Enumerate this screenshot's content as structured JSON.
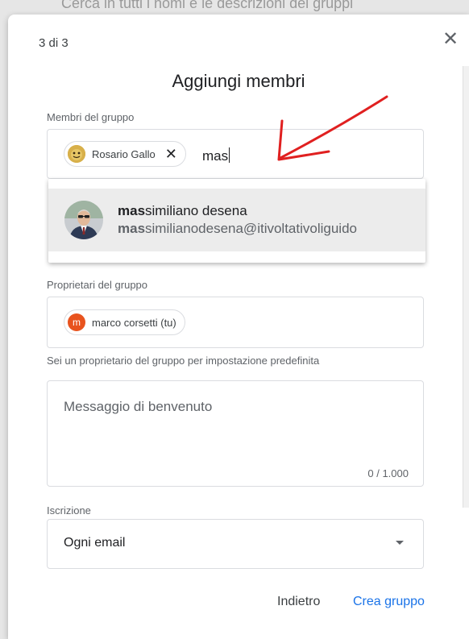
{
  "background": {
    "text": "Cerca in tutti i nomi e le descrizioni dei gruppi"
  },
  "dialog": {
    "step": "3 di 3",
    "title": "Aggiungi membri",
    "close_icon": "close-icon"
  },
  "members": {
    "label": "Membri del gruppo",
    "chips": [
      {
        "name": "Rosario Gallo",
        "remove": "✕"
      }
    ],
    "typed_value": "mas"
  },
  "suggestion": {
    "name_match": "mas",
    "name_rest": "similiano desena",
    "email_match": "mas",
    "email_rest": "similianodesena@itivoltativoliguido"
  },
  "owners": {
    "label": "Proprietari del gruppo",
    "chip": {
      "initial": "m",
      "name": "marco corsetti (tu)",
      "color": "#e8531e"
    },
    "hint": "Sei un proprietario del gruppo per impostazione predefinita"
  },
  "welcome": {
    "placeholder": "Messaggio di benvenuto",
    "counter": "0 / 1.000"
  },
  "subscription": {
    "label": "Iscrizione",
    "value": "Ogni email"
  },
  "footer": {
    "back_label": "Indietro",
    "create_label": "Crea gruppo"
  },
  "colors": {
    "accent": "#1a73e8",
    "annotation_arrow": "#e02020"
  }
}
